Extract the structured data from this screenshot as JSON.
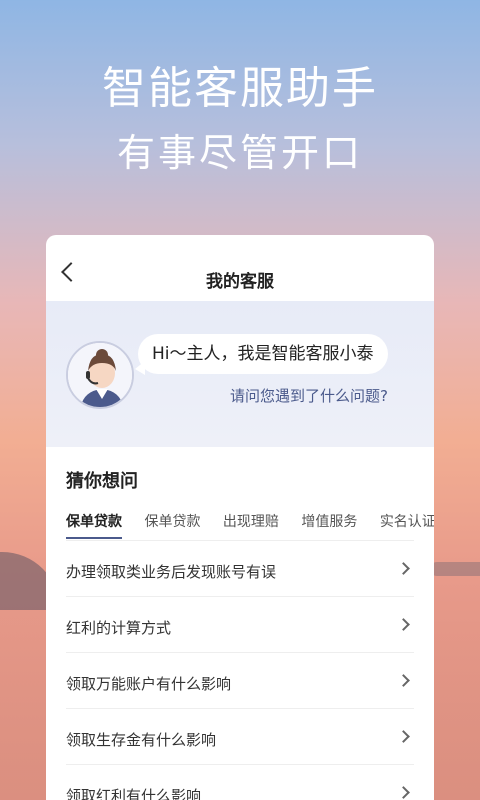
{
  "hero": {
    "title": "智能客服助手",
    "subtitle": "有事尽管开口"
  },
  "card": {
    "header": {
      "title": "我的客服"
    },
    "welcome": {
      "greeting": "Hi～主人，我是智能客服小泰",
      "question": "请问您遇到了什么问题?"
    },
    "faq": {
      "title": "猜你想问",
      "tabs": [
        {
          "label": "保单贷款",
          "active": true
        },
        {
          "label": "保单贷款"
        },
        {
          "label": "出现理赔"
        },
        {
          "label": "增值服务"
        },
        {
          "label": "实名认证"
        }
      ],
      "items": [
        {
          "label": "办理领取类业务后发现账号有误"
        },
        {
          "label": "红利的计算方式"
        },
        {
          "label": "领取万能账户有什么影响"
        },
        {
          "label": "领取生存金有什么影响"
        },
        {
          "label": "领取红利有什么影响"
        }
      ]
    }
  }
}
